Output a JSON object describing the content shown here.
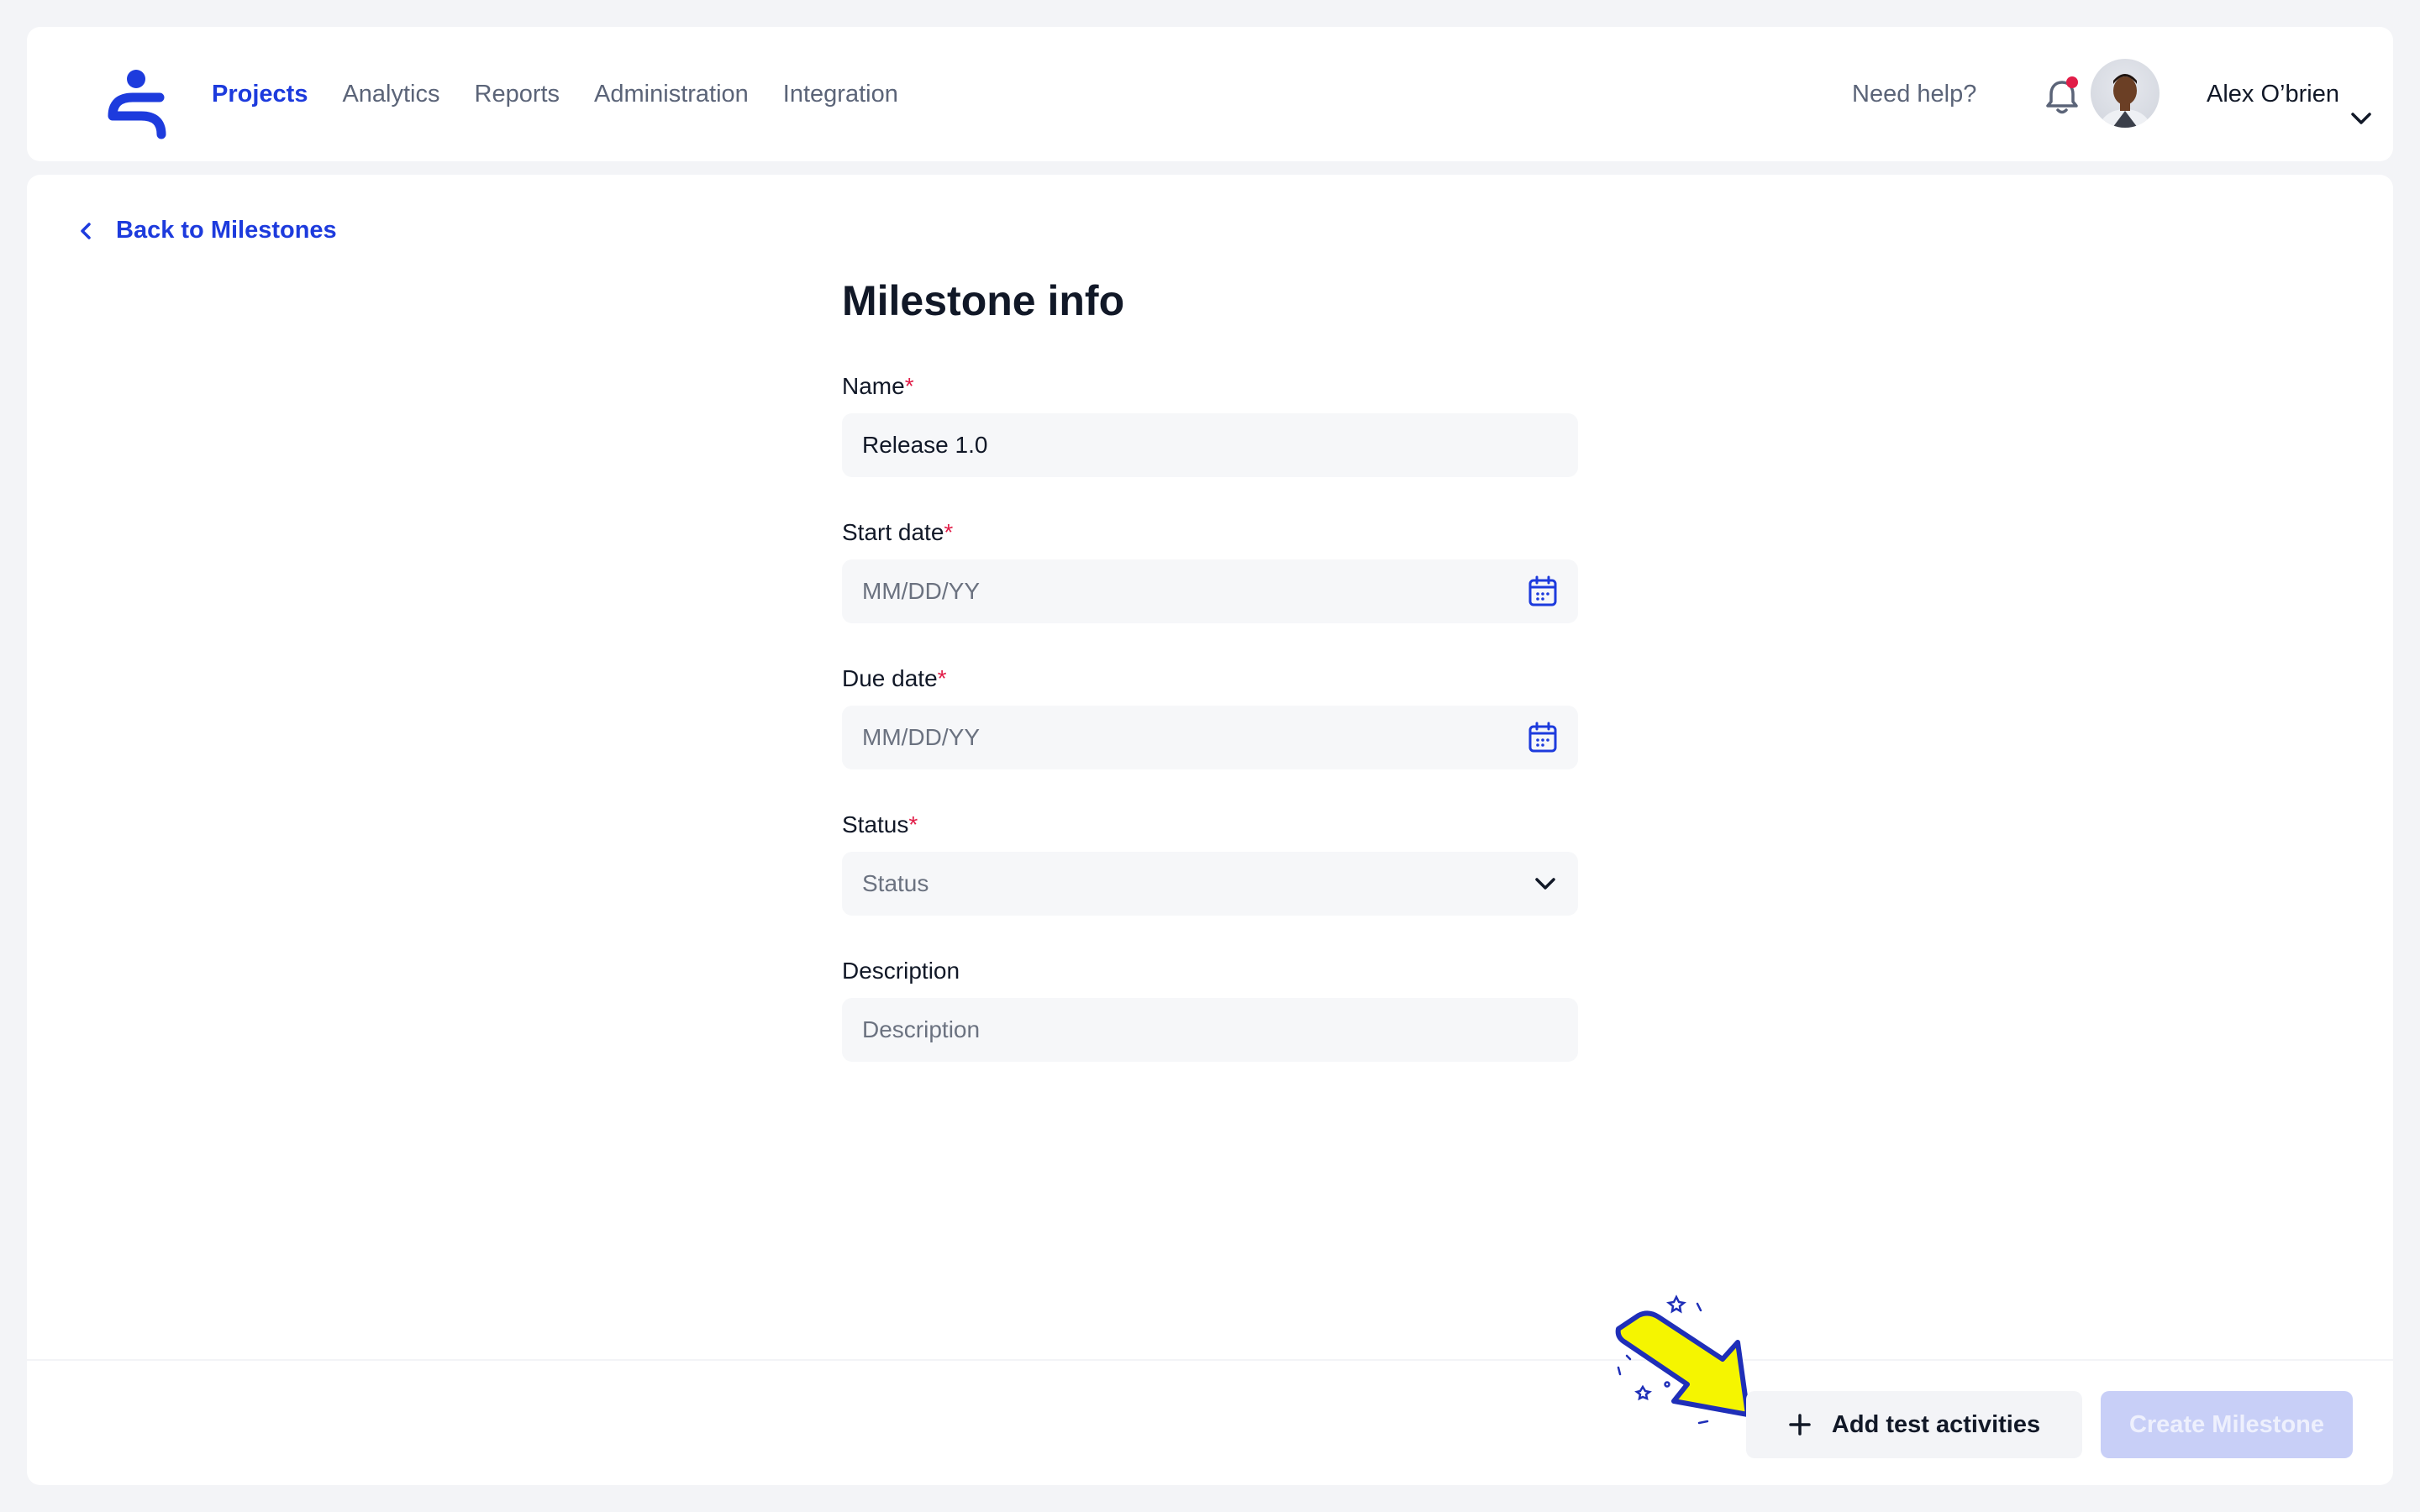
{
  "header": {
    "nav": [
      "Projects",
      "Analytics",
      "Reports",
      "Administration",
      "Integration"
    ],
    "active_nav": "Projects",
    "help_label": "Need help?",
    "user_name": "Alex O’brien"
  },
  "back_link": "Back to Milestones",
  "form": {
    "title": "Milestone info",
    "name": {
      "label": "Name",
      "value": "Release 1.0"
    },
    "start_date": {
      "label": "Start date",
      "placeholder": "MM/DD/YY"
    },
    "due_date": {
      "label": "Due date",
      "placeholder": "MM/DD/YY"
    },
    "status": {
      "label": "Status",
      "placeholder": "Status"
    },
    "description": {
      "label": "Description",
      "placeholder": "Description"
    },
    "required_marker": "*"
  },
  "footer": {
    "add_label": "Add test activities",
    "create_label": "Create Milestone"
  },
  "colors": {
    "accent": "#1d3bdd",
    "required": "#e11d48",
    "highlight_arrow": "#f5f500"
  },
  "icons": [
    "logo-icon",
    "bell-icon",
    "chevron-down-icon",
    "chevron-left-icon",
    "calendar-icon",
    "plus-icon",
    "arrow-icon"
  ]
}
